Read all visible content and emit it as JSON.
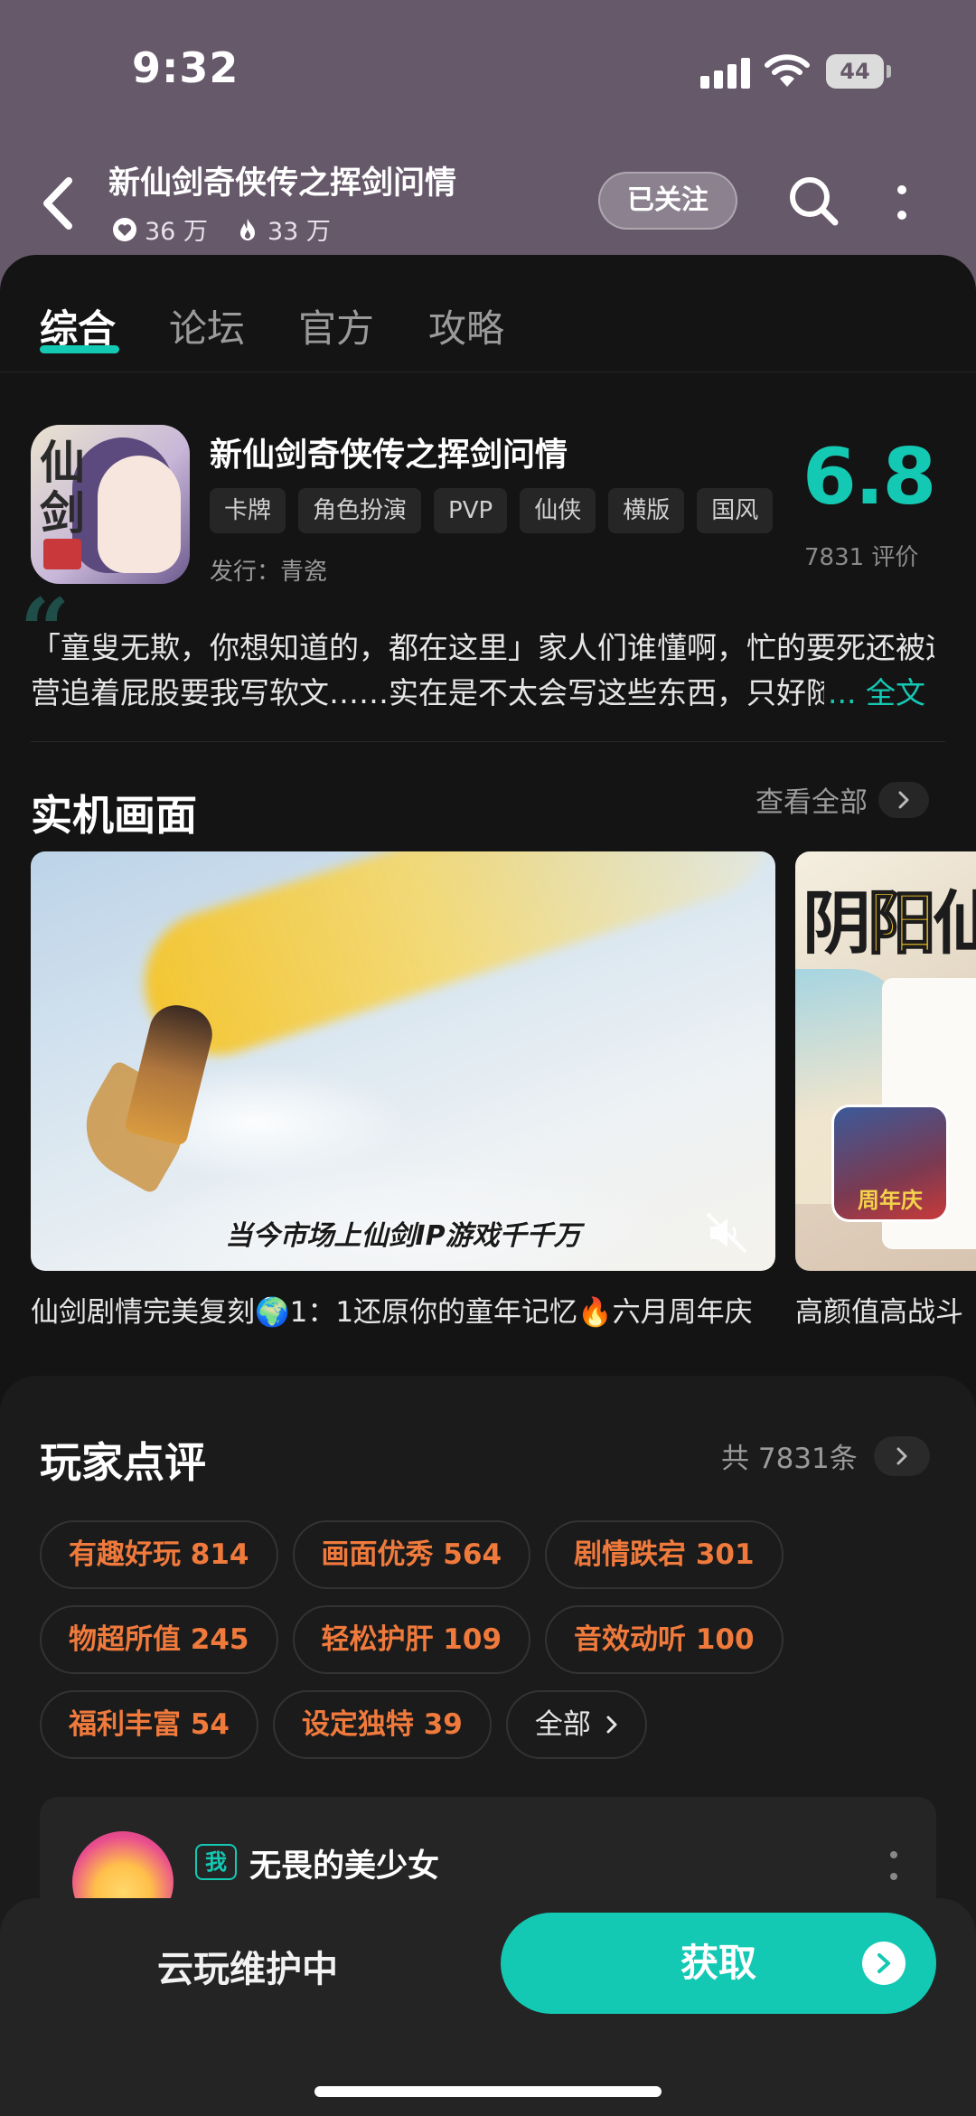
{
  "status_bar": {
    "time": "9:32",
    "battery": "44"
  },
  "header": {
    "title": "新仙剑奇侠传之挥剑问情",
    "likes": "36 万",
    "heat": "33 万",
    "follow_label": "已关注"
  },
  "tabs": [
    {
      "label": "综合",
      "active": true
    },
    {
      "label": "论坛",
      "active": false
    },
    {
      "label": "官方",
      "active": false
    },
    {
      "label": "攻略",
      "active": false
    }
  ],
  "app": {
    "icon_text": "仙剑",
    "title": "新仙剑奇侠传之挥剑问情",
    "tags": [
      "卡牌",
      "角色扮演",
      "PVP",
      "仙侠",
      "横版",
      "国风"
    ],
    "publisher": "发行：青瓷",
    "score": "6.8",
    "rating_count": "7831 评价"
  },
  "description": {
    "line1": "「童叟无欺，你想知道的，都在这里」家人们谁懂啊，忙的要死还被运",
    "line2": "营追着屁股要我写软文……实在是不太会写这些东西，只好随",
    "read_more": "... 全文"
  },
  "screenshots": {
    "title": "实机画面",
    "view_all": "查看全部",
    "videos": [
      {
        "caption": "仙剑剧情完美复刻🌍1：1还原你的童年记忆🔥六月周年庆",
        "subtitle": "当今市场上仙剑IP游戏千千万"
      },
      {
        "caption": "高颜值高战斗",
        "title_a": "阴",
        "title_b": "阳",
        "title_c": "仙",
        "badge": "周年庆"
      }
    ]
  },
  "reviews": {
    "title": "玩家点评",
    "total": "共 7831条",
    "tags": [
      [
        "有趣好玩 814",
        "画面优秀 564",
        "剧情跌宕 301"
      ],
      [
        "物超所值 245",
        "轻松护肝 109",
        "音效动听 100"
      ],
      [
        "福利丰富 54",
        "设定独特 39"
      ]
    ],
    "all_label": "全部",
    "first_review": {
      "me_badge": "我",
      "name": "无畏的美少女"
    }
  },
  "bottom_bar": {
    "cloud_status": "云玩维护中",
    "get_label": "获取"
  },
  "colors": {
    "accent": "#14c9b4",
    "tag_orange": "#f07a3c",
    "header_bg": "#66596a",
    "card_bg": "#141414"
  },
  "icons": [
    "back-arrow-icon",
    "heart-icon",
    "flame-icon",
    "search-icon",
    "more-vertical-icon",
    "chevron-right-icon",
    "mute-icon",
    "arrow-right-circle-icon",
    "signal-icon",
    "wifi-icon",
    "battery-icon"
  ]
}
